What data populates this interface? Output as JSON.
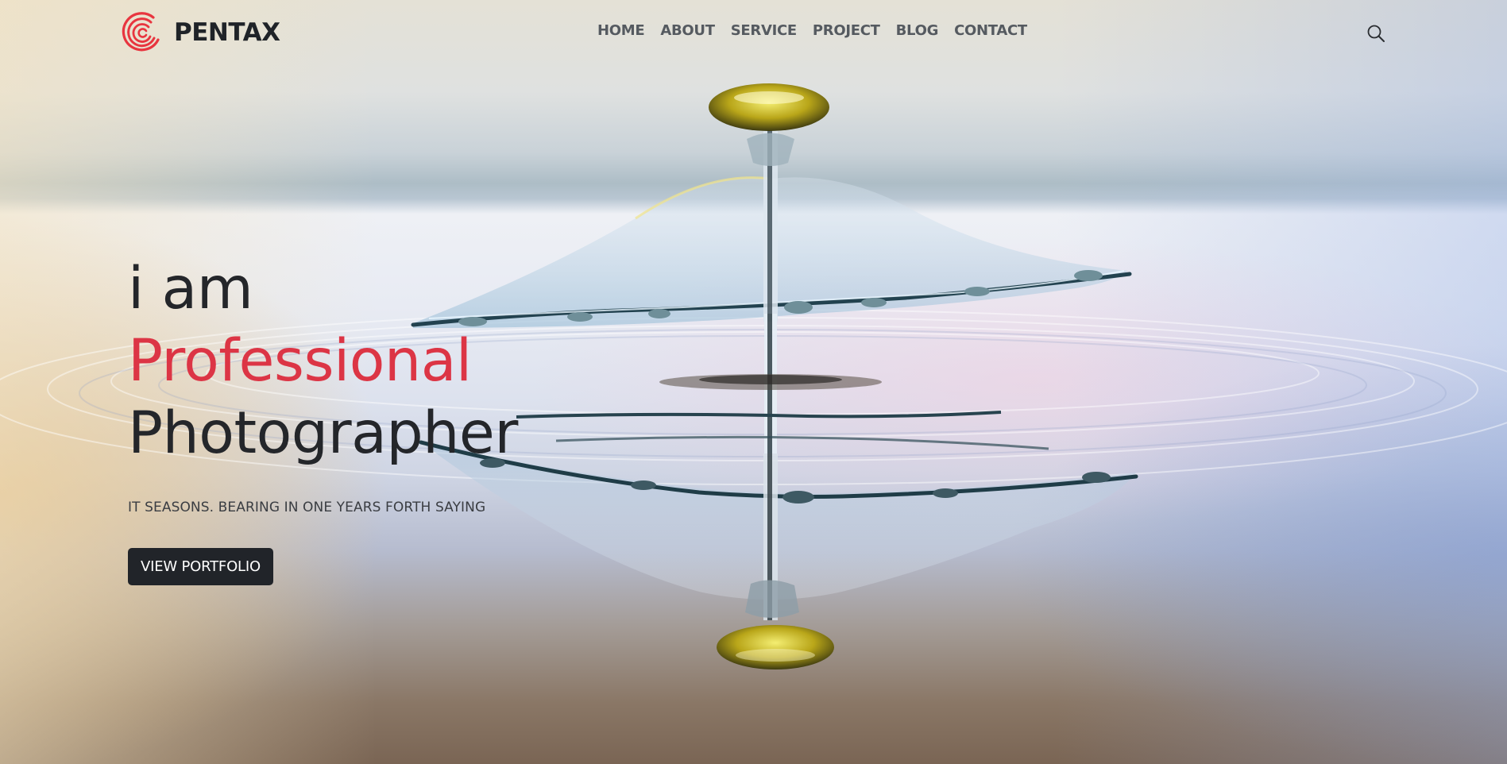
{
  "brand": {
    "name": "PENTAX",
    "logo_icon": "concentric-circles-logo-icon",
    "logo_color": "#e8353f"
  },
  "nav": {
    "items": [
      {
        "label": "HOME"
      },
      {
        "label": "ABOUT"
      },
      {
        "label": "SERVICE"
      },
      {
        "label": "PROJECT"
      },
      {
        "label": "BLOG"
      },
      {
        "label": "CONTACT"
      }
    ],
    "search_icon": "search-icon"
  },
  "hero": {
    "line1": "i am",
    "line2": "Professional",
    "line3": "Photographer",
    "tagline": "IT SEASONS. BEARING IN ONE YEARS FORTH SAYING",
    "cta_label": "VIEW PORTFOLIO",
    "background": "water-droplet-splash-photo"
  },
  "colors": {
    "accent": "#dc3545",
    "text_dark": "#24262a",
    "button_bg": "#212429",
    "nav_text": "#555a60"
  }
}
